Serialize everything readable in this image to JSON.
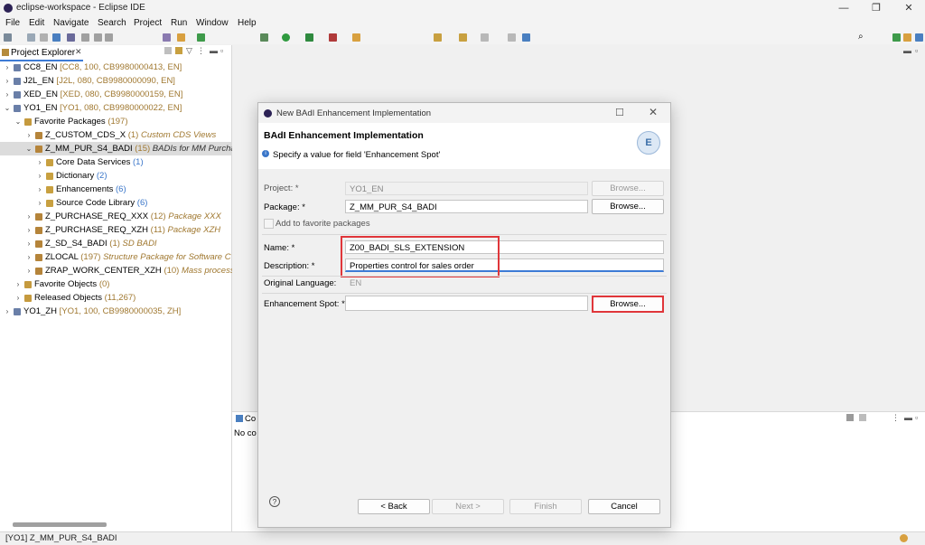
{
  "window": {
    "title": "eclipse-workspace - Eclipse IDE",
    "controls": [
      "—",
      "❐",
      "✕"
    ]
  },
  "menubar": [
    "File",
    "Edit",
    "Navigate",
    "Search",
    "Project",
    "Run",
    "Window",
    "Help"
  ],
  "project_explorer": {
    "tab_label": "Project Explorer",
    "tree": [
      {
        "label": "CC8_EN",
        "decoration": "[CC8, 100, CB9980000413, EN]",
        "level": 0,
        "expanded": false
      },
      {
        "label": "J2L_EN",
        "decoration": "[J2L, 080, CB9980000090, EN]",
        "level": 0,
        "expanded": false
      },
      {
        "label": "XED_EN",
        "decoration": "[XED, 080, CB9980000159, EN]",
        "level": 0,
        "expanded": false
      },
      {
        "label": "YO1_EN",
        "decoration": "[YO1, 080, CB9980000022, EN]",
        "level": 0,
        "expanded": true
      },
      {
        "label": "Favorite Packages",
        "decoration": "(197)",
        "level": 1,
        "expanded": true
      },
      {
        "label": "Z_CUSTOM_CDS_X",
        "decoration": "(1)",
        "desc": "Custom CDS Views",
        "level": 2,
        "expanded": false
      },
      {
        "label": "Z_MM_PUR_S4_BADI",
        "decoration": "(15)",
        "desc": "BADIs for MM Purcha",
        "level": 2,
        "expanded": true,
        "selected": true
      },
      {
        "label": "Core Data Services",
        "decoration": "(1)",
        "level": 3,
        "expanded": false
      },
      {
        "label": "Dictionary",
        "decoration": "(2)",
        "level": 3,
        "expanded": false
      },
      {
        "label": "Enhancements",
        "decoration": "(6)",
        "level": 3,
        "expanded": false
      },
      {
        "label": "Source Code Library",
        "decoration": "(6)",
        "level": 3,
        "expanded": false
      },
      {
        "label": "Z_PURCHASE_REQ_XXX",
        "decoration": "(12)",
        "desc": "Package XXX",
        "level": 2,
        "expanded": false
      },
      {
        "label": "Z_PURCHASE_REQ_XZH",
        "decoration": "(11)",
        "desc": "Package XZH",
        "level": 2,
        "expanded": false
      },
      {
        "label": "Z_SD_S4_BADI",
        "decoration": "(1)",
        "desc": "SD BADI",
        "level": 2,
        "expanded": false
      },
      {
        "label": "ZLOCAL",
        "decoration": "(197)",
        "desc": "Structure Package for Software C",
        "level": 2,
        "expanded": false
      },
      {
        "label": "ZRAP_WORK_CENTER_XZH",
        "decoration": "(10)",
        "desc": "Mass processing",
        "level": 2,
        "expanded": false
      },
      {
        "label": "Favorite Objects",
        "decoration": "(0)",
        "level": 1,
        "expanded": false
      },
      {
        "label": "Released Objects",
        "decoration": "(11,267)",
        "level": 1,
        "expanded": false
      },
      {
        "label": "YO1_ZH",
        "decoration": "[YO1, 100, CB9980000035, ZH]",
        "level": 0,
        "expanded": false
      }
    ]
  },
  "bottom_view": {
    "tab_label": "Co",
    "content": "No co"
  },
  "status_bar": {
    "text": "[YO1] Z_MM_PUR_S4_BADI"
  },
  "dialog": {
    "title": "New BAdI Enhancement Implementation",
    "heading": "BAdI Enhancement Implementation",
    "message": "Specify a value for field 'Enhancement Spot'",
    "logo_letter": "E",
    "project_label": "Project: *",
    "project_value": "YO1_EN",
    "package_label": "Package: *",
    "package_value": "Z_MM_PUR_S4_BADI",
    "browse_label": "Browse...",
    "favorite_label": "Add to favorite packages",
    "name_label": "Name: *",
    "name_value": "Z00_BADI_SLS_EXTENSION",
    "description_label": "Description: *",
    "description_value": "Properties control for sales order",
    "orig_lang_label": "Original Language:",
    "orig_lang_value": "EN",
    "enh_spot_label": "Enhancement Spot: *",
    "enh_spot_value": "",
    "back_label": "< Back",
    "next_label": "Next >",
    "finish_label": "Finish",
    "cancel_label": "Cancel",
    "help_label": "?"
  },
  "colors": {
    "highlight_border": "#e0363a",
    "accent": "#3d7bd5"
  }
}
